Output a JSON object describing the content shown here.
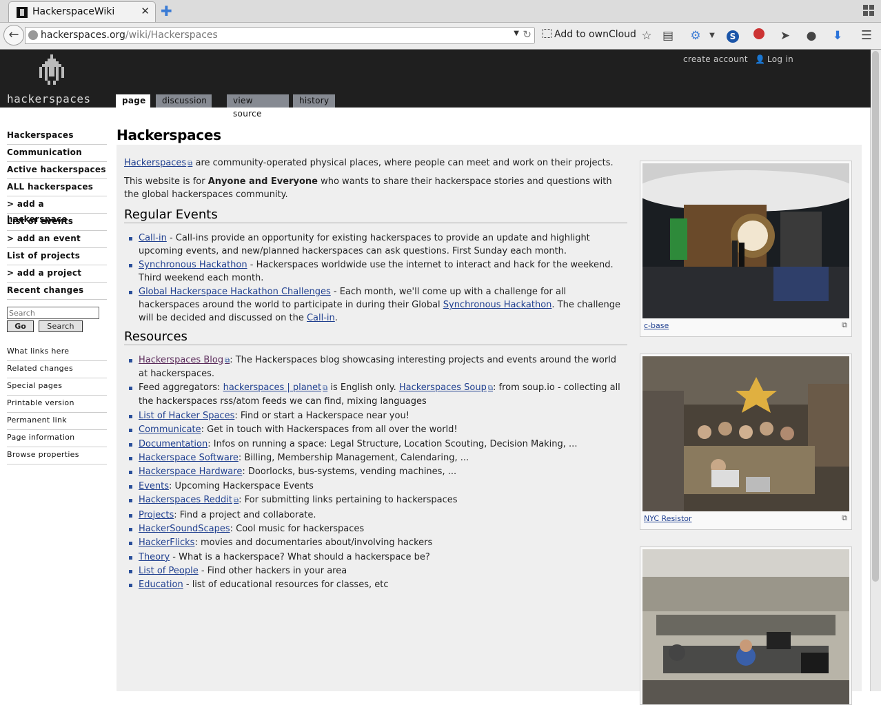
{
  "browser": {
    "tab_title": "HackerspaceWiki",
    "url_host": "hackerspaces.org",
    "url_path": "/wiki/Hackerspaces",
    "owncloud_label": "Add to ownCloud"
  },
  "header": {
    "logo_text": "hackerspaces",
    "create_account": "create account",
    "login": "Log in",
    "tabs": [
      "page",
      "discussion",
      "view source",
      "history"
    ]
  },
  "sidebar": {
    "nav": [
      "Hackerspaces",
      "Communication",
      "Active hackerspaces",
      "ALL hackerspaces",
      "> add a hackerspace",
      "List of events",
      "> add an event",
      "List of projects",
      "> add a project",
      "Recent changes"
    ],
    "search_placeholder": "Search",
    "go_label": "Go",
    "search_label": "Search",
    "toolbox": [
      "What links here",
      "Related changes",
      "Special pages",
      "Printable version",
      "Permanent link",
      "Page information",
      "Browse properties"
    ]
  },
  "content": {
    "title": "Hackerspaces",
    "intro_link": "Hackerspaces",
    "intro_rest": " are community-operated physical places, where people can meet and work on their projects.",
    "audience_pre": "This website is for ",
    "audience_bold": "Anyone and Everyone",
    "audience_post": " who wants to share their hackerspace stories and questions with the global hackerspaces community.",
    "events_heading": "Regular Events",
    "event1_link": "Call-in",
    "event1_text": " - Call-ins provide an opportunity for existing hackerspaces to provide an update and highlight upcoming events, and new/planned hackerspaces can ask questions. First Sunday each month.",
    "event2_link": "Synchronous Hackathon",
    "event2_text": " - Hackerspaces worldwide use the internet to interact and hack for the weekend. Third weekend each month.",
    "event3_link": "Global Hackerspace Hackathon Challenges",
    "event3_text_a": " - Each month, we'll come up with a challenge for all hackerspaces around the world to participate in during their Global ",
    "event3_link2": "Synchronous Hackathon",
    "event3_text_b": ". The challenge will be decided and discussed on the ",
    "event3_link3": "Call-in",
    "event3_text_c": ".",
    "resources_heading": "Resources",
    "res1_link": "Hackerspaces Blog",
    "res1_text": ": The Hackerspaces blog showcasing interesting projects and events around the world at hackerspaces.",
    "res2_pre": "Feed aggregators: ",
    "res2_link1": "hackerspaces | planet",
    "res2_mid": " is English only. ",
    "res2_link2": "Hackerspaces Soup",
    "res2_post": ": from soup.io - collecting all the hackerspaces rss/atom feeds we can find, mixing languages",
    "res3_link": "List of Hacker Spaces",
    "res3_text": ": Find or start a Hackerspace near you!",
    "res4_link": "Communicate",
    "res4_text": ": Get in touch with Hackerspaces from all over the world!",
    "res5_link": "Documentation",
    "res5_text": ": Infos on running a space: Legal Structure, Location Scouting, Decision Making, ...",
    "res6_link": "Hackerspace Software",
    "res6_text": ": Billing, Membership Management, Calendaring, ...",
    "res7_link": "Hackerspace Hardware",
    "res7_text": ": Doorlocks, bus-systems, vending machines, ...",
    "res8_link": "Events",
    "res8_text": ": Upcoming Hackerspace Events",
    "res9_link": "Hackerspaces Reddit",
    "res9_text": ": For submitting links pertaining to hackerspaces",
    "res10_link": "Projects",
    "res10_text": ": Find a project and collaborate.",
    "res11_link": "HackerSoundScapes",
    "res11_text": ": Cool music for hackerspaces",
    "res12_link": "HackerFlicks",
    "res12_text": ": movies and documentaries about/involving hackers",
    "res13_link": "Theory",
    "res13_text": " - What is a hackerspace? What should a hackerspace be?",
    "res14_link": "List of People",
    "res14_text": " - Find other hackers in your area",
    "res15_link": "Education",
    "res15_text": " - list of educational resources for classes, etc"
  },
  "thumbs": {
    "cbase_caption": "c-base",
    "nyc_caption": "NYC Resistor"
  }
}
